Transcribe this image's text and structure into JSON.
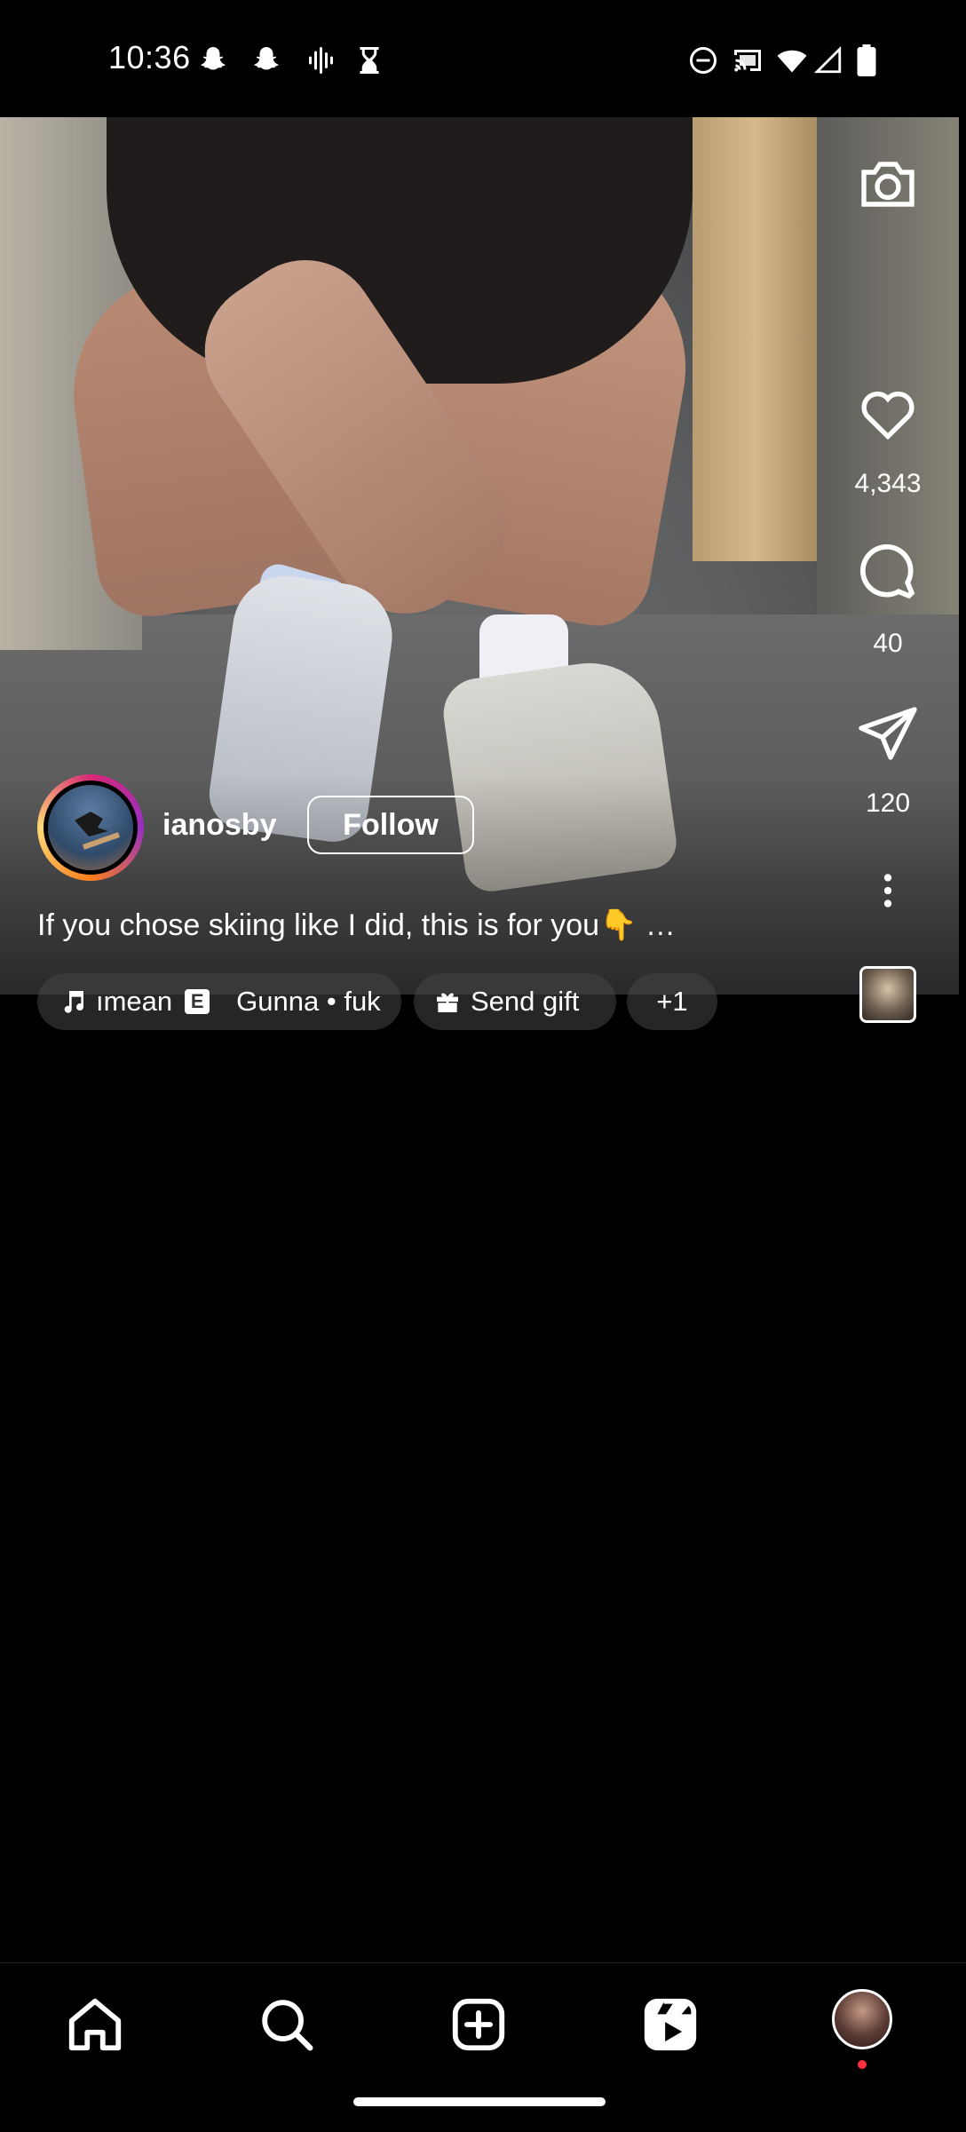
{
  "status_bar": {
    "time": "10:36",
    "left_icons": [
      "snapchat-icon",
      "snapchat-icon",
      "voice-recorder-icon",
      "hourglass-icon"
    ],
    "right_icons": [
      "do-not-disturb-icon",
      "cast-icon",
      "wifi-icon",
      "signal-icon",
      "battery-icon"
    ]
  },
  "reel": {
    "creator": {
      "username": "ianosby",
      "follow_label": "Follow"
    },
    "caption": "If you chose skiing like I did, this is for you👇 …",
    "audio": {
      "track_partial": "ımean",
      "explicit_badge": "E",
      "artist_track": "Gunna • fuk"
    },
    "send_gift_label": "Send gift",
    "more_chip_label": "+1",
    "actions": {
      "likes": "4,343",
      "comments": "40",
      "shares": "120"
    }
  },
  "bottom_nav": {
    "items": [
      "home-icon",
      "search-icon",
      "create-icon",
      "reels-icon",
      "profile-avatar"
    ]
  },
  "colors": {
    "background": "#000000",
    "text": "#ffffff",
    "notification_dot": "#ff3040",
    "story_ring": [
      "#d62976",
      "#962fbf",
      "#fa7e1e",
      "#feda75"
    ]
  }
}
